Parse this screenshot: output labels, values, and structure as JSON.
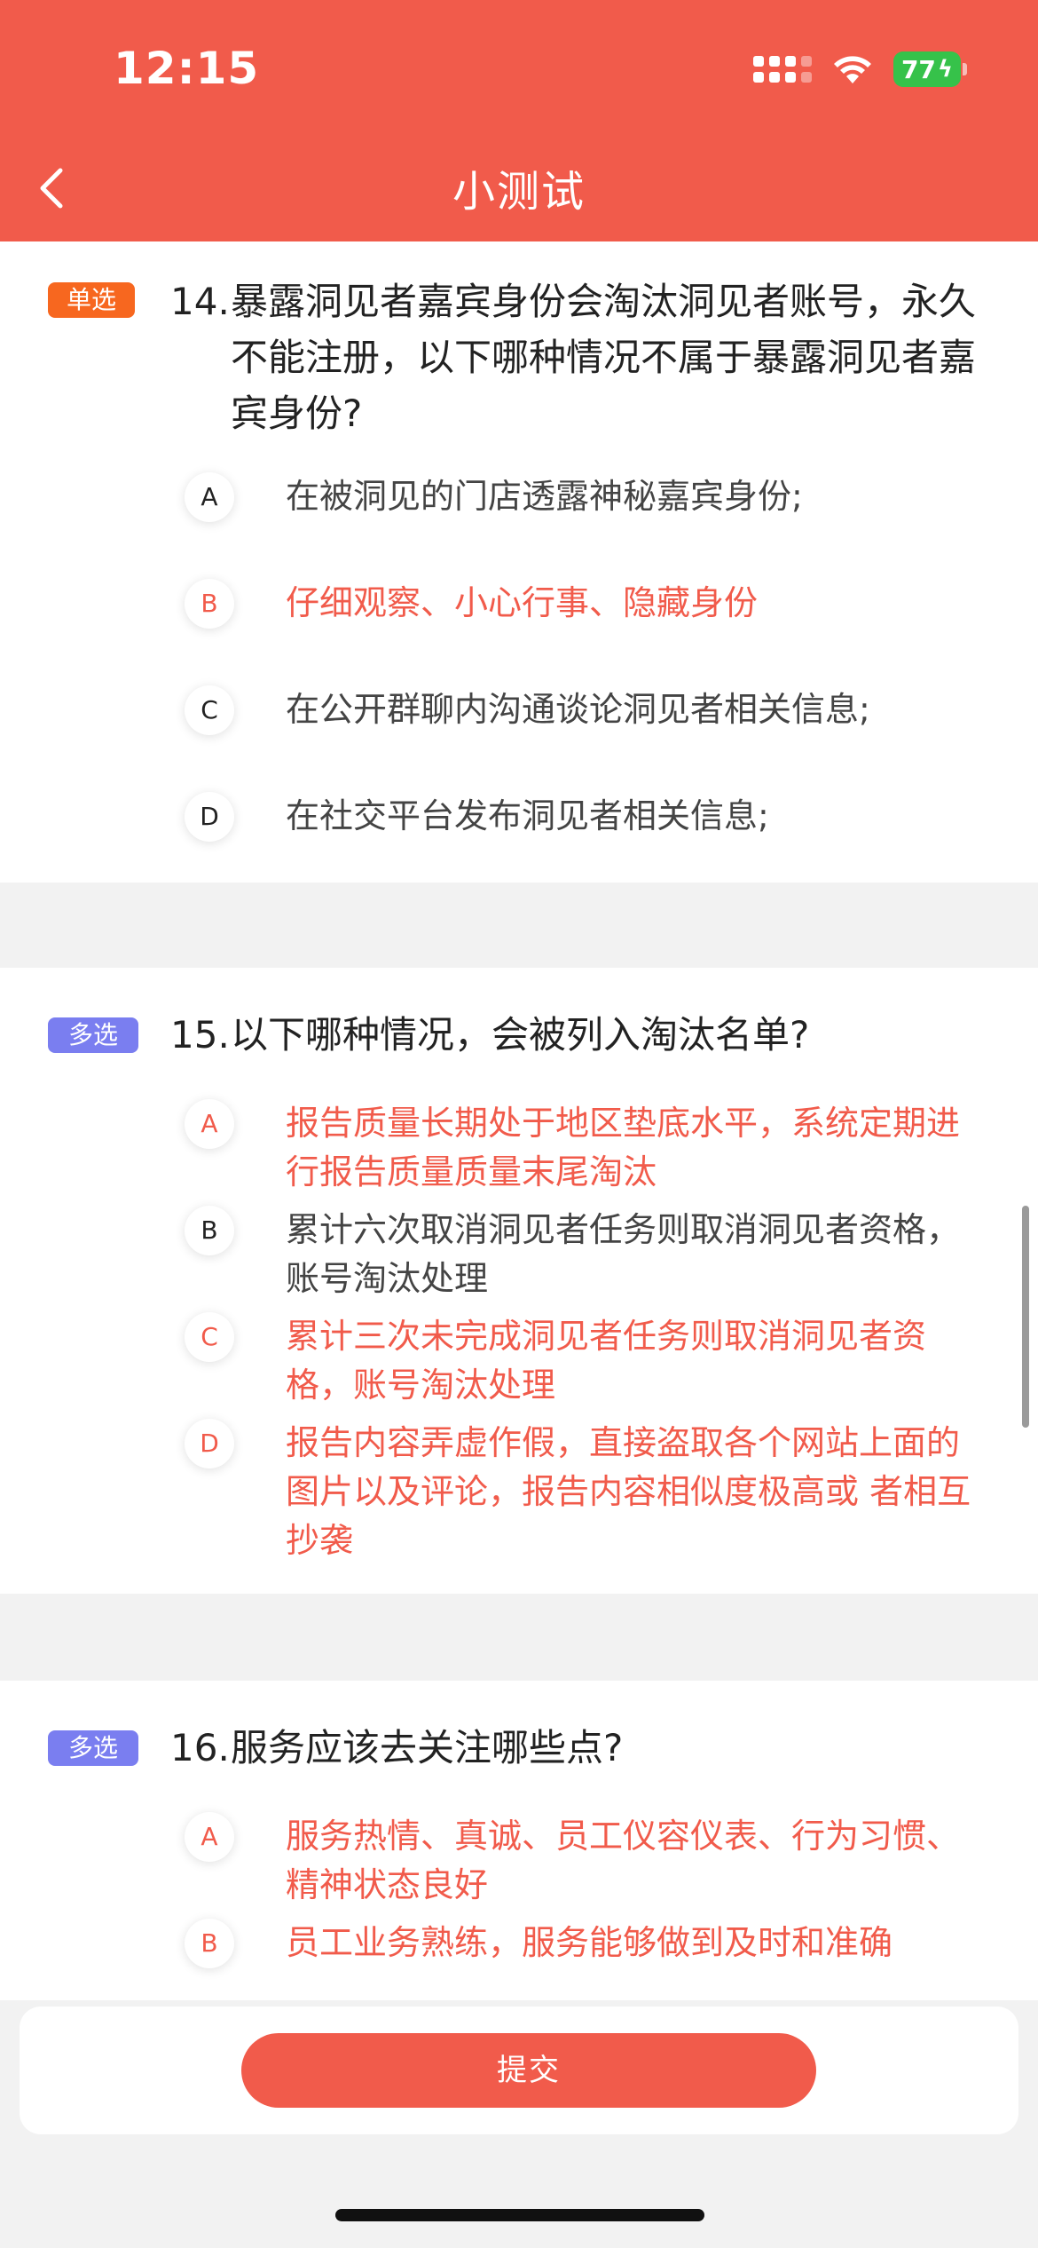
{
  "status": {
    "time": "12:15",
    "battery": "77"
  },
  "nav": {
    "title": "小测试"
  },
  "questions": [
    {
      "type_label": "单选",
      "number": "14.",
      "text": "暴露洞见者嘉宾身份会淘汰洞见者账号，永久不能注册，以下哪种情况不属于暴露洞见者嘉宾身份?",
      "options": [
        {
          "letter": "A",
          "text": "在被洞见的门店透露神秘嘉宾身份;"
        },
        {
          "letter": "B",
          "text": "仔细观察、小心行事、隐藏身份"
        },
        {
          "letter": "C",
          "text": "在公开群聊内沟通谈论洞见者相关信息;"
        },
        {
          "letter": "D",
          "text": "在社交平台发布洞见者相关信息;"
        }
      ]
    },
    {
      "type_label": "多选",
      "number": "15.",
      "text": "以下哪种情况，会被列入淘汰名单?",
      "options": [
        {
          "letter": "A",
          "text": "报告质量长期处于地区垫底水平，系统定期进行报告质量质量末尾淘汰"
        },
        {
          "letter": "B",
          "text": "累计六次取消洞见者任务则取消洞见者资格，账号淘汰处理"
        },
        {
          "letter": "C",
          "text": "累计三次未完成洞见者任务则取消洞见者资格，账号淘汰处理"
        },
        {
          "letter": "D",
          "text": "报告内容弄虚作假，直接盗取各个网站上面的图片以及评论，报告内容相似度极高或 者相互抄袭"
        }
      ]
    },
    {
      "type_label": "多选",
      "number": "16.",
      "text": "服务应该去关注哪些点?",
      "options": [
        {
          "letter": "A",
          "text": "服务热情、真诚、员工仪容仪表、行为习惯、精神状态良好"
        },
        {
          "letter": "B",
          "text": "员工业务熟练，服务能够做到及时和准确"
        }
      ]
    }
  ],
  "submit_label": "提交",
  "colors": {
    "brand": "#f15b4b",
    "single_badge": "#f7671f",
    "multi_badge": "#7a7ef0"
  }
}
